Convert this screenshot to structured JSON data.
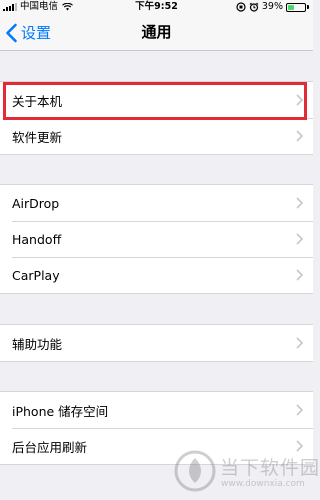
{
  "status_bar": {
    "carrier": "中国电信",
    "time": "下午9:52",
    "battery_text": "39%",
    "battery_level": 0.39
  },
  "nav": {
    "back_label": "设置",
    "title": "通用"
  },
  "groups": [
    {
      "items": [
        {
          "label": "关于本机",
          "highlighted": true
        },
        {
          "label": "软件更新"
        }
      ]
    },
    {
      "items": [
        {
          "label": "AirDrop"
        },
        {
          "label": "Handoff"
        },
        {
          "label": "CarPlay"
        }
      ]
    },
    {
      "items": [
        {
          "label": "辅助功能"
        }
      ]
    },
    {
      "items": [
        {
          "label": "iPhone 储存空间"
        },
        {
          "label": "后台应用刷新"
        }
      ]
    }
  ],
  "watermark": {
    "text": "当下软件园",
    "url": "www.downxia.com"
  },
  "colors": {
    "accent": "#007aff",
    "highlight_border": "#e32b35",
    "background": "#efeff4",
    "battery": "#4cd964"
  }
}
